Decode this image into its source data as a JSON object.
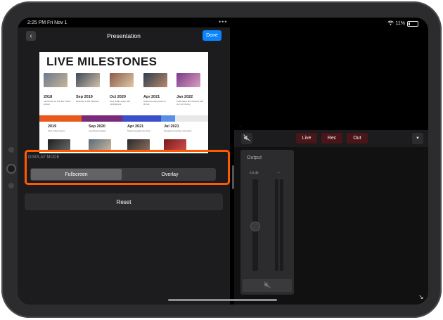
{
  "status_bar": {
    "time": "2:25 PM",
    "date": "Fri Nov 1",
    "dots": "•••",
    "battery_pct": "11%"
  },
  "nav": {
    "back_icon": "chevron-left-icon",
    "title": "Presentation",
    "done": "Done"
  },
  "slide": {
    "title": "LIVE MILESTONES",
    "top_row": [
      {
        "label": "2018",
        "desc": "Launched our first live Twitch stream"
      },
      {
        "label": "Sep 2019",
        "desc": "Reached 1,000 followers"
      },
      {
        "label": "Oct 2020",
        "desc": "New studio setup with multicamera"
      },
      {
        "label": "Apr 2021",
        "desc": "Added remote guests to shows"
      },
      {
        "label": "Jan 2022",
        "desc": "Celebrated 100 streams with our community"
      }
    ],
    "bottom_row": [
      {
        "label": "2019",
        "desc": "First collab stream"
      },
      {
        "label": "Sep 2020",
        "desc": "Launched podcast"
      },
      {
        "label": "Apr 2021",
        "desc": "Started weekly live show"
      },
      {
        "label": "Jul 2021",
        "desc": "Integrated overlays and alerts"
      }
    ],
    "bar_colors": [
      "#e8591a",
      "#7a2a7a",
      "#3a4fc9",
      "#5a8fe6",
      "#e8e8e8"
    ]
  },
  "display_mode": {
    "label": "DISPLAY MODE",
    "options": [
      "Fullscreen",
      "Overlay"
    ],
    "selected": "Fullscreen"
  },
  "reset_label": "Reset",
  "controls": {
    "mute_icon": "speaker-slash-icon",
    "live": "Live",
    "rec": "Rec",
    "out": "Out",
    "dropdown_icon": "chevron-down-icon"
  },
  "output_panel": {
    "title": "Output",
    "db": "0.0 db",
    "channel_marks": "- -",
    "mute_icon": "speaker-slash-icon",
    "fader_level": 0.45
  },
  "colors": {
    "accent": "#0a84ff",
    "highlight": "#ff5a00",
    "record_pill": "#4a1518"
  }
}
